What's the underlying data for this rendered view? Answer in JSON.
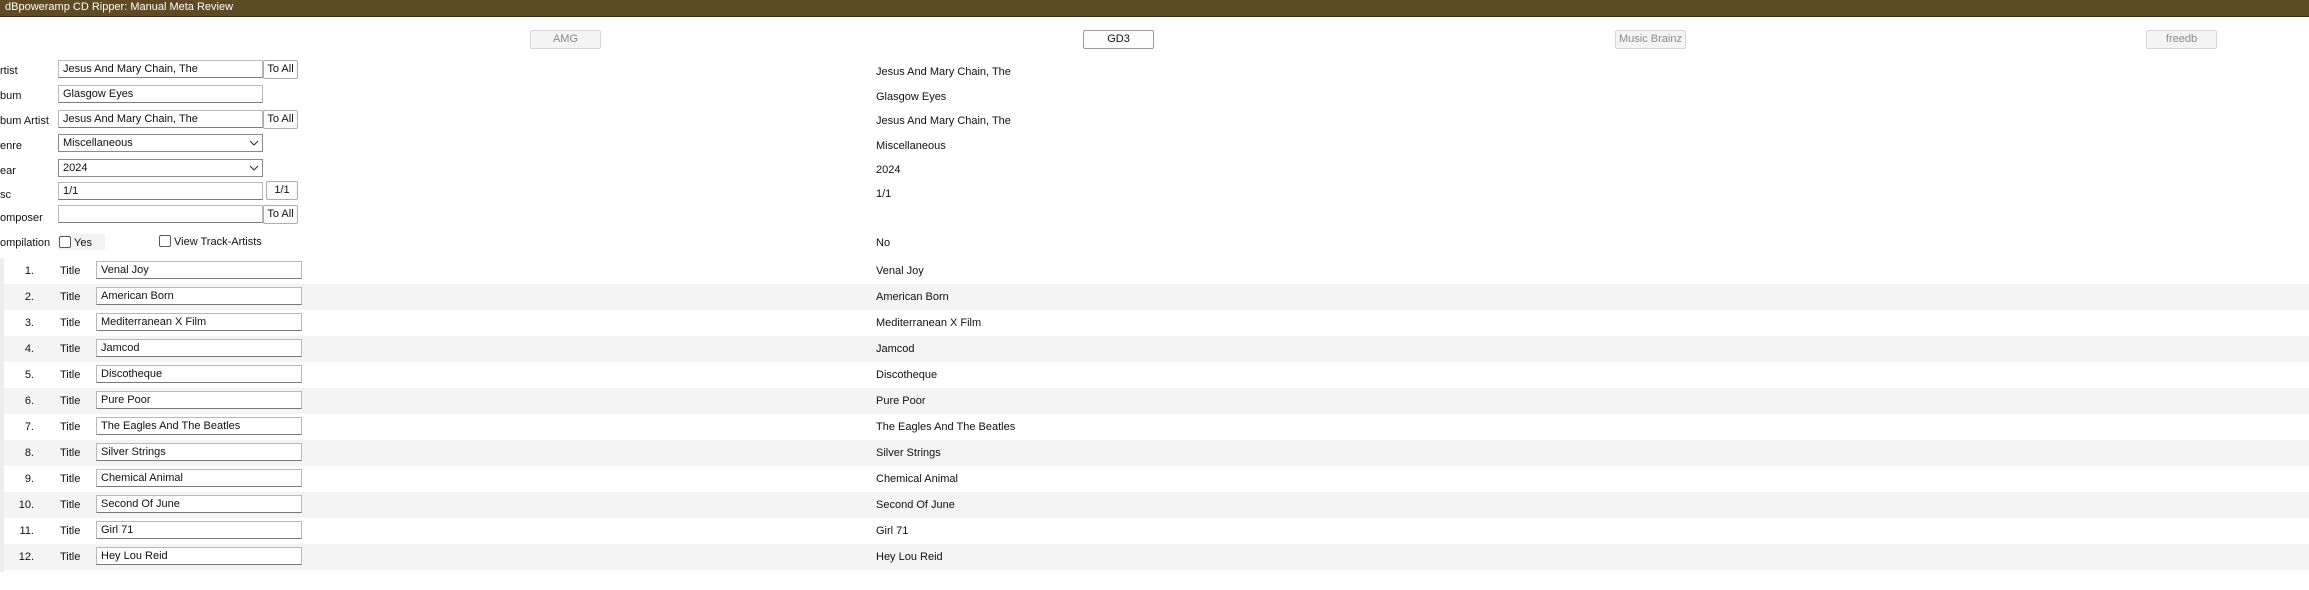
{
  "window": {
    "title": "dBpoweramp CD Ripper: Manual Meta Review"
  },
  "sources": [
    {
      "label": "AMG",
      "active": false
    },
    {
      "label": "GD3",
      "active": true
    },
    {
      "label": "Music Brainz",
      "active": false
    },
    {
      "label": "freedb",
      "active": false
    }
  ],
  "fields": {
    "artist": {
      "label": "rtist",
      "value": "Jesus And Mary Chain, The",
      "button": "To All",
      "source_value": "Jesus And Mary Chain, The"
    },
    "album": {
      "label": "bum",
      "value": "Glasgow Eyes",
      "source_value": "Glasgow Eyes"
    },
    "album_artist": {
      "label": "bum Artist",
      "value": "Jesus And Mary Chain, The",
      "button": "To All",
      "source_value": "Jesus And Mary Chain, The"
    },
    "genre": {
      "label": "enre",
      "value": "Miscellaneous",
      "source_value": "Miscellaneous"
    },
    "year": {
      "label": "ear",
      "value": "2024",
      "source_value": "2024"
    },
    "disc": {
      "label": "sc",
      "value": "1/1",
      "button": "1/1",
      "source_value": "1/1"
    },
    "composer": {
      "label": "omposer",
      "value": "",
      "button": "To All"
    },
    "compilation": {
      "label": "ompilation",
      "checkbox_label": "Yes",
      "checked": false,
      "source_value": "No"
    }
  },
  "view_track_artists": {
    "label": "View Track-Artists",
    "checked": false
  },
  "tracks": [
    {
      "num": "1.",
      "field": "Title",
      "value": "Venal Joy",
      "source": "Venal Joy"
    },
    {
      "num": "2.",
      "field": "Title",
      "value": "American Born",
      "source": "American Born"
    },
    {
      "num": "3.",
      "field": "Title",
      "value": "Mediterranean X Film",
      "source": "Mediterranean X Film"
    },
    {
      "num": "4.",
      "field": "Title",
      "value": "Jamcod",
      "source": "Jamcod"
    },
    {
      "num": "5.",
      "field": "Title",
      "value": "Discotheque",
      "source": "Discotheque"
    },
    {
      "num": "6.",
      "field": "Title",
      "value": "Pure Poor",
      "source": "Pure Poor"
    },
    {
      "num": "7.",
      "field": "Title",
      "value": "The Eagles And The Beatles",
      "source": "The Eagles And The Beatles"
    },
    {
      "num": "8.",
      "field": "Title",
      "value": "Silver Strings",
      "source": "Silver Strings"
    },
    {
      "num": "9.",
      "field": "Title",
      "value": "Chemical Animal",
      "source": "Chemical Animal"
    },
    {
      "num": "10.",
      "field": "Title",
      "value": "Second Of June",
      "source": "Second Of June"
    },
    {
      "num": "11.",
      "field": "Title",
      "value": "Girl 71",
      "source": "Girl 71"
    },
    {
      "num": "12.",
      "field": "Title",
      "value": "Hey Lou Reid",
      "source": "Hey Lou Reid"
    }
  ],
  "icons": {
    "dropdown": "chevron-down-icon"
  },
  "colors": {
    "titlebar": "#5e4a24",
    "row_alt": "#f4f4f4"
  }
}
